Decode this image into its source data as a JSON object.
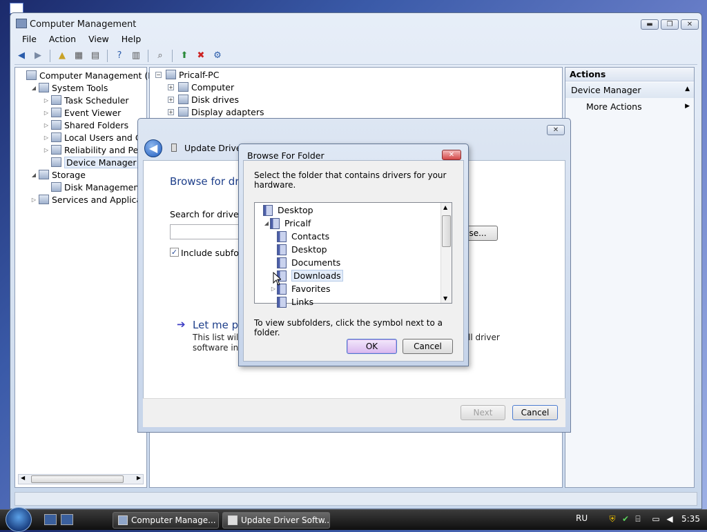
{
  "window": {
    "title": "Computer Management",
    "min": "▬",
    "max": "❐",
    "close": "✕"
  },
  "menu": [
    "File",
    "Action",
    "View",
    "Help"
  ],
  "left_tree": [
    {
      "label": "Computer Management (Local",
      "indent": 0,
      "arrow": ""
    },
    {
      "label": "System Tools",
      "indent": 1,
      "arrow": "◢"
    },
    {
      "label": "Task Scheduler",
      "indent": 2,
      "arrow": "▷"
    },
    {
      "label": "Event Viewer",
      "indent": 2,
      "arrow": "▷"
    },
    {
      "label": "Shared Folders",
      "indent": 2,
      "arrow": "▷"
    },
    {
      "label": "Local Users and Group",
      "indent": 2,
      "arrow": "▷"
    },
    {
      "label": "Reliability and Perform",
      "indent": 2,
      "arrow": "▷"
    },
    {
      "label": "Device Manager",
      "indent": 2,
      "arrow": "",
      "selected": true
    },
    {
      "label": "Storage",
      "indent": 1,
      "arrow": "◢"
    },
    {
      "label": "Disk Management",
      "indent": 2,
      "arrow": ""
    },
    {
      "label": "Services and Applications",
      "indent": 1,
      "arrow": "▷"
    }
  ],
  "device_tree": [
    {
      "label": "Pricalf-PC",
      "pm": "−",
      "indent": 0
    },
    {
      "label": "Computer",
      "pm": "+",
      "indent": 1
    },
    {
      "label": "Disk drives",
      "pm": "+",
      "indent": 1
    },
    {
      "label": "Display adapters",
      "pm": "+",
      "indent": 1
    }
  ],
  "actions": {
    "header": "Actions",
    "section": "Device Manager",
    "section_arrow": "▲",
    "more": "More Actions",
    "more_arrow": "▶"
  },
  "wizard": {
    "title": "Update Driver S",
    "heading": "Browse for driv",
    "search_label": "Search for driver so",
    "browse_btn": "se...",
    "include_sub": "Include subfolde",
    "let_me_pick": "Let me pic",
    "list_text1": "This list will s",
    "list_text2": "software in th",
    "list_text_right": "ll driver",
    "next": "Next",
    "cancel": "Cancel",
    "close": "✕"
  },
  "browse_dialog": {
    "title": "Browse For Folder",
    "instruction": "Select the folder that contains drivers for your hardware.",
    "hint": "To view subfolders, click the symbol next to a folder.",
    "ok": "OK",
    "cancel": "Cancel",
    "folders": [
      {
        "label": "Desktop",
        "indent": 0,
        "arrow": ""
      },
      {
        "label": "Pricalf",
        "indent": 1,
        "arrow": "◢"
      },
      {
        "label": "Contacts",
        "indent": 2,
        "arrow": ""
      },
      {
        "label": "Desktop",
        "indent": 2,
        "arrow": ""
      },
      {
        "label": "Documents",
        "indent": 2,
        "arrow": ""
      },
      {
        "label": "Downloads",
        "indent": 2,
        "arrow": "",
        "selected": true
      },
      {
        "label": "Favorites",
        "indent": 2,
        "arrow": "▷"
      },
      {
        "label": "Links",
        "indent": 2,
        "arrow": ""
      }
    ]
  },
  "taskbar": {
    "tasks": [
      "Computer Manage...",
      "Update Driver Softw..."
    ],
    "lang": "RU",
    "clock": "5:35"
  }
}
